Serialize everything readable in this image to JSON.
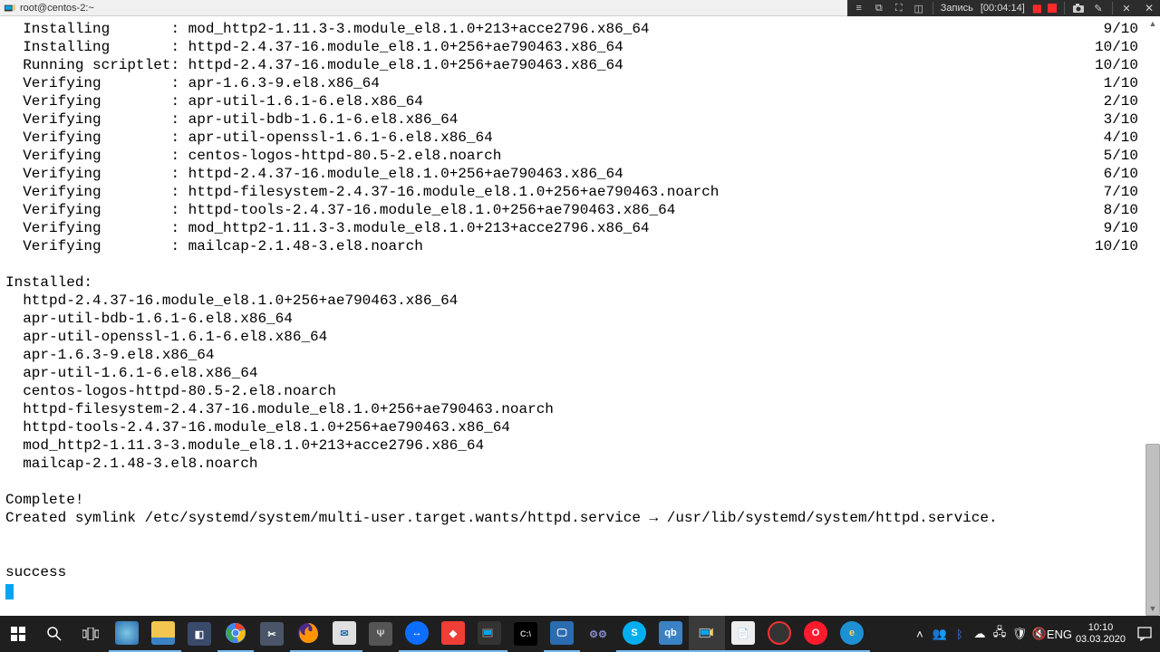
{
  "window": {
    "title": "root@centos-2:~"
  },
  "recording": {
    "label": "Запись",
    "time": "[00:04:14]"
  },
  "terminal": {
    "progress": [
      {
        "stage": "  Installing       ",
        "pkg": ": mod_http2-1.11.3-3.module_el8.1.0+213+acce2796.x86_64",
        "count": "9/10"
      },
      {
        "stage": "  Installing       ",
        "pkg": ": httpd-2.4.37-16.module_el8.1.0+256+ae790463.x86_64",
        "count": "10/10"
      },
      {
        "stage": "  Running scriptlet",
        "pkg": ": httpd-2.4.37-16.module_el8.1.0+256+ae790463.x86_64",
        "count": "10/10"
      },
      {
        "stage": "  Verifying        ",
        "pkg": ": apr-1.6.3-9.el8.x86_64",
        "count": "1/10"
      },
      {
        "stage": "  Verifying        ",
        "pkg": ": apr-util-1.6.1-6.el8.x86_64",
        "count": "2/10"
      },
      {
        "stage": "  Verifying        ",
        "pkg": ": apr-util-bdb-1.6.1-6.el8.x86_64",
        "count": "3/10"
      },
      {
        "stage": "  Verifying        ",
        "pkg": ": apr-util-openssl-1.6.1-6.el8.x86_64",
        "count": "4/10"
      },
      {
        "stage": "  Verifying        ",
        "pkg": ": centos-logos-httpd-80.5-2.el8.noarch",
        "count": "5/10"
      },
      {
        "stage": "  Verifying        ",
        "pkg": ": httpd-2.4.37-16.module_el8.1.0+256+ae790463.x86_64",
        "count": "6/10"
      },
      {
        "stage": "  Verifying        ",
        "pkg": ": httpd-filesystem-2.4.37-16.module_el8.1.0+256+ae790463.noarch",
        "count": "7/10"
      },
      {
        "stage": "  Verifying        ",
        "pkg": ": httpd-tools-2.4.37-16.module_el8.1.0+256+ae790463.x86_64",
        "count": "8/10"
      },
      {
        "stage": "  Verifying        ",
        "pkg": ": mod_http2-1.11.3-3.module_el8.1.0+213+acce2796.x86_64",
        "count": "9/10"
      },
      {
        "stage": "  Verifying        ",
        "pkg": ": mailcap-2.1.48-3.el8.noarch",
        "count": "10/10"
      }
    ],
    "installed_header": "Installed:",
    "installed": [
      "  httpd-2.4.37-16.module_el8.1.0+256+ae790463.x86_64",
      "  apr-util-bdb-1.6.1-6.el8.x86_64",
      "  apr-util-openssl-1.6.1-6.el8.x86_64",
      "  apr-1.6.3-9.el8.x86_64",
      "  apr-util-1.6.1-6.el8.x86_64",
      "  centos-logos-httpd-80.5-2.el8.noarch",
      "  httpd-filesystem-2.4.37-16.module_el8.1.0+256+ae790463.noarch",
      "  httpd-tools-2.4.37-16.module_el8.1.0+256+ae790463.x86_64",
      "  mod_http2-1.11.3-3.module_el8.1.0+213+acce2796.x86_64",
      "  mailcap-2.1.48-3.el8.noarch"
    ],
    "complete": "Complete!",
    "symlink": "Created symlink /etc/systemd/system/multi-user.target.wants/httpd.service → /usr/lib/systemd/system/httpd.service.",
    "success": "success"
  },
  "tray": {
    "lang": "ENG",
    "time": "10:10",
    "date": "03.03.2020"
  }
}
